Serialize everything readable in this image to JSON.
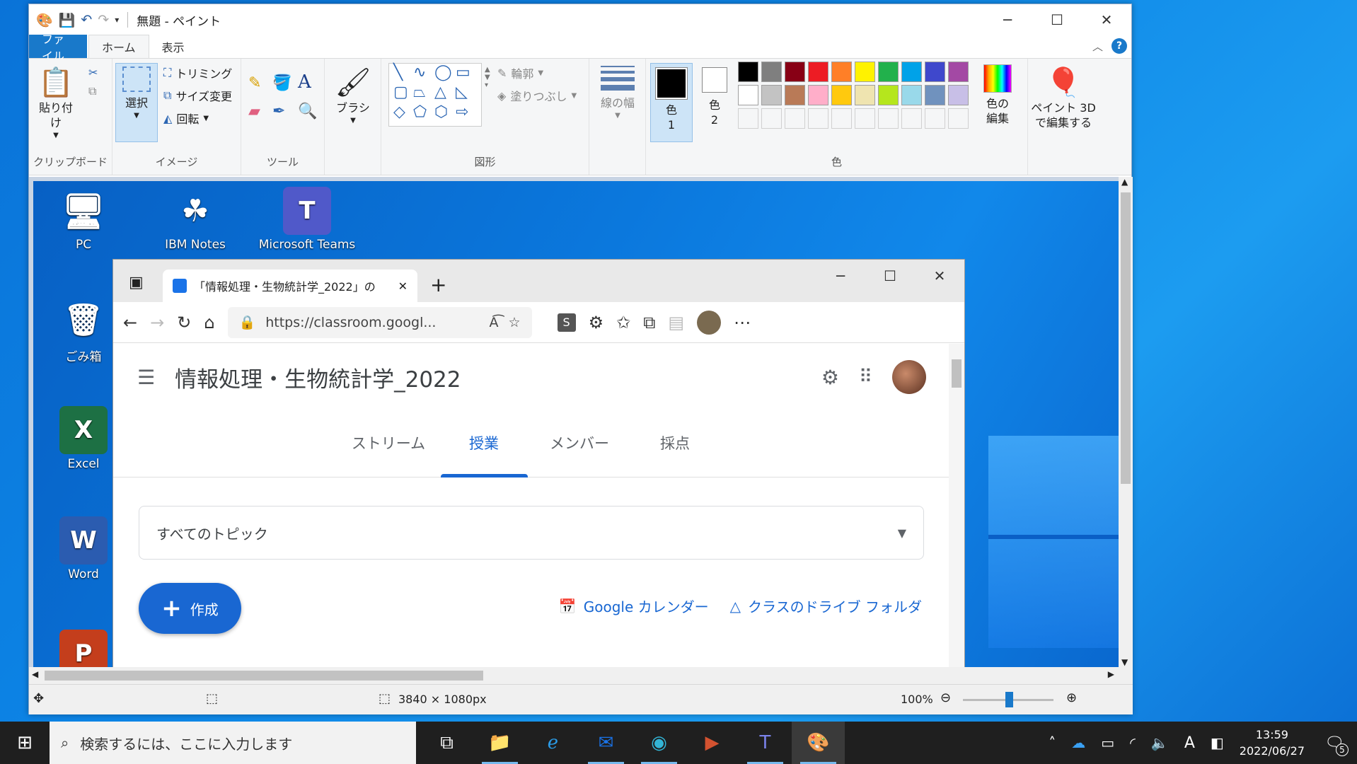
{
  "paint": {
    "title": "無題 - ペイント",
    "tabs": [
      "ファイル",
      "ホーム",
      "表示"
    ],
    "clipboard": {
      "paste": "貼り付け",
      "label": "クリップボード"
    },
    "image": {
      "select": "選択",
      "crop": "トリミング",
      "resize": "サイズ変更",
      "rotate": "回転",
      "label": "イメージ"
    },
    "tools": {
      "label": "ツール"
    },
    "brush": {
      "label": "ブラシ"
    },
    "shapes": {
      "outline": "輪郭",
      "fill": "塗りつぶし",
      "label": "図形"
    },
    "size": {
      "label": "線の幅"
    },
    "colors": {
      "color1": "色\n1",
      "color1_a": "色",
      "color1_b": "1",
      "color2_a": "色",
      "color2_b": "2",
      "edit": "色の",
      "edit2": "編集",
      "label": "色",
      "palette_row1": [
        "#000000",
        "#7f7f7f",
        "#880015",
        "#ed1c24",
        "#ff7f27",
        "#fff200",
        "#22b14c",
        "#00a2e8",
        "#3f48cc",
        "#a349a4"
      ],
      "palette_row2": [
        "#ffffff",
        "#c3c3c3",
        "#b97a57",
        "#ffaec9",
        "#ffc90e",
        "#efe4b0",
        "#b5e61d",
        "#99d9ea",
        "#7092be",
        "#c8bfe7"
      ]
    },
    "paint3d": {
      "a": "ペイント 3D",
      "b": "で編集する"
    },
    "status": {
      "dimensions": "3840 × 1080px",
      "zoom": "100%"
    }
  },
  "desktop": {
    "icons": [
      "PC",
      "IBM Notes",
      "Microsoft Teams",
      "ごみ箱",
      "Excel",
      "Word"
    ]
  },
  "edge": {
    "tab_title": "「情報処理・生物統計学_2022」の",
    "url": "https://classroom.googl...",
    "ext_label": "S"
  },
  "classroom": {
    "title": "情報処理・生物統計学_2022",
    "tabs": [
      "ストリーム",
      "授業",
      "メンバー",
      "採点"
    ],
    "active_tab": "授業",
    "topic_filter": "すべてのトピック",
    "create": "作成",
    "calendar": "Google カレンダー",
    "drive": "クラスのドライブ フォルダ"
  },
  "taskbar": {
    "search_placeholder": "検索するには、ここに入力します",
    "time": "13:59",
    "date": "2022/06/27",
    "ime": "A",
    "notifications": "5"
  }
}
